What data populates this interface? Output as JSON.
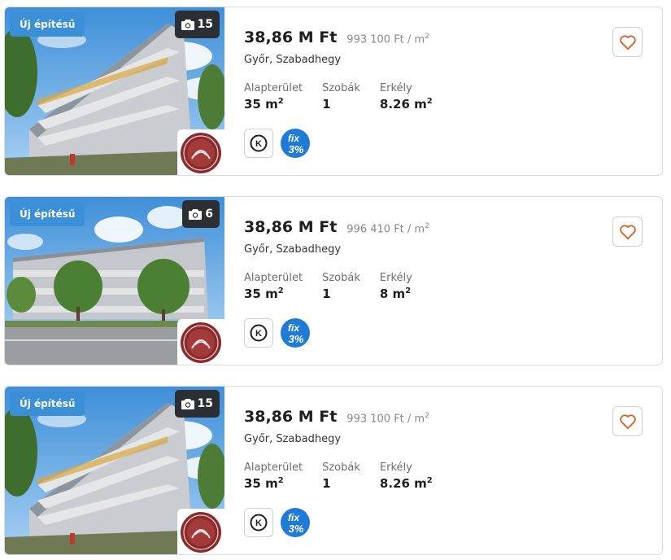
{
  "listings": [
    {
      "badge": "Új építésű",
      "photo_count": "15",
      "price": "38,86 M Ft",
      "sqm_price": "993 100 Ft / m",
      "sqm_unit_exp": "2",
      "location": "Győr, Szabadhegy",
      "stats": [
        {
          "label": "Alapterület",
          "value": "35 m",
          "exp": "2"
        },
        {
          "label": "Szobák",
          "value": "1",
          "exp": ""
        },
        {
          "label": "Erkély",
          "value": "8.26 m",
          "exp": "2"
        }
      ],
      "tag_k": "K",
      "tag_fix": [
        "fix",
        "3%"
      ]
    },
    {
      "badge": "Új építésű",
      "photo_count": "6",
      "price": "38,86 M Ft",
      "sqm_price": "996 410 Ft / m",
      "sqm_unit_exp": "2",
      "location": "Győr, Szabadhegy",
      "stats": [
        {
          "label": "Alapterület",
          "value": "35 m",
          "exp": "2"
        },
        {
          "label": "Szobák",
          "value": "1",
          "exp": ""
        },
        {
          "label": "Erkély",
          "value": "8 m",
          "exp": "2"
        }
      ],
      "tag_k": "K",
      "tag_fix": [
        "fix",
        "3%"
      ]
    },
    {
      "badge": "Új építésű",
      "photo_count": "15",
      "price": "38,86 M Ft",
      "sqm_price": "993 100 Ft / m",
      "sqm_unit_exp": "2",
      "location": "Győr, Szabadhegy",
      "stats": [
        {
          "label": "Alapterület",
          "value": "35 m",
          "exp": "2"
        },
        {
          "label": "Szobák",
          "value": "1",
          "exp": ""
        },
        {
          "label": "Erkély",
          "value": "8.26 m",
          "exp": "2"
        }
      ],
      "tag_k": "K",
      "tag_fix": [
        "fix",
        "3%"
      ]
    }
  ],
  "icons": {
    "photo_count": "camera-icon",
    "favorite": "heart-outline-icon",
    "tag_k": "k-circle-icon",
    "tag_fix": "fix-3-percent-icon",
    "agency": "agency-logo-emblem"
  },
  "colors": {
    "badge_bg": "#3a8fd6",
    "heart": "#d4622c",
    "fix_badge": "#1f7bd6",
    "agency_logo": "#8b2a2a",
    "photo_count_bg": "#2b2f33"
  }
}
